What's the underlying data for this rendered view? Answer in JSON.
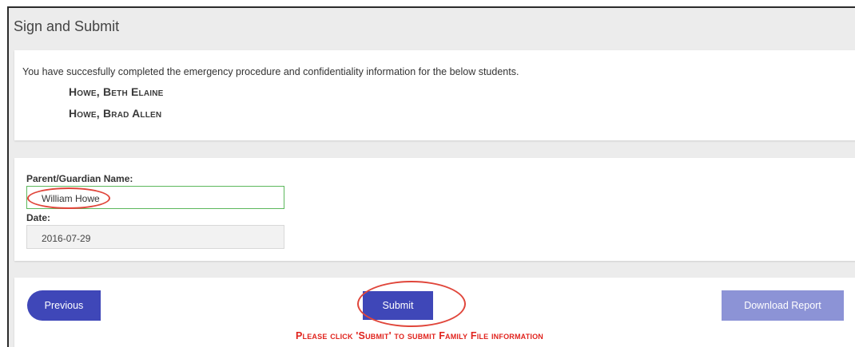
{
  "header": {
    "title": "Sign and Submit"
  },
  "students_panel": {
    "intro": "You have succesfully completed the emergency procedure and confidentiality information for the below students.",
    "students": [
      "Howe, Beth Elaine",
      "Howe, Brad Allen"
    ]
  },
  "form": {
    "name_label": "Parent/Guardian Name:",
    "name_value": "William Howe",
    "date_label": "Date:",
    "date_value": "2016-07-29"
  },
  "actions": {
    "previous_label": "Previous",
    "submit_label": "Submit",
    "download_label": "Download Report",
    "notice": "Please click 'Submit' to submit Family File information"
  },
  "colors": {
    "primary": "#3f47b8",
    "primary_disabled": "#8c93d6",
    "annotation": "#e0463b",
    "notice": "#e0231d",
    "valid_border": "#5cb85c"
  }
}
